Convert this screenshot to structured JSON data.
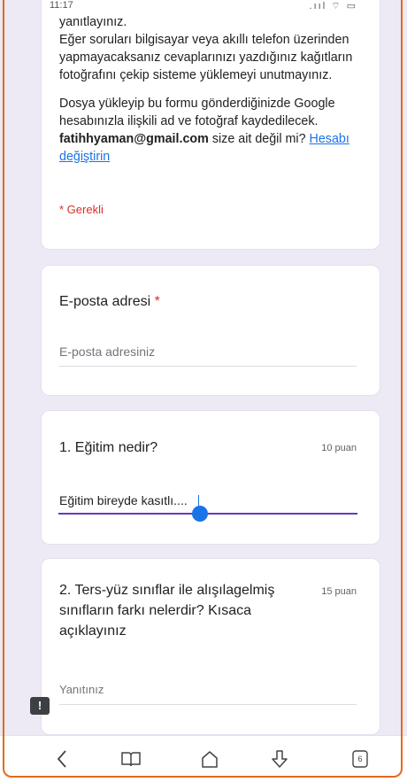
{
  "status": {
    "time": "11:17",
    "icons": ".ııl ⌔ ▭"
  },
  "intro": {
    "line_top": "yanıtlayınız.",
    "para1": "Eğer soruları bilgisayar veya akıllı telefon üzerinden yapmayacaksanız cevaplarınızı yazdığınız kağıtların fotoğrafını çekip sisteme yüklemeyi unutmayınız.",
    "para2_a": "Dosya yükleyip bu formu gönderdiğinizde Google hesabınızla ilişkili ad ve fotoğraf kaydedilecek. ",
    "email": "fatihhyaman@gmail.com",
    "para2_b": " size ait değil mi? ",
    "switch_account": "Hesabı değiştirin",
    "required_note": "* Gerekli"
  },
  "email_question": {
    "title": "E-posta adresi",
    "required_mark": "*",
    "placeholder": "E-posta adresiniz"
  },
  "question1": {
    "title": "1. Eğitim nedir?",
    "points": "10 puan",
    "answer": "Eğitim bireyde kasıtlı...."
  },
  "question2": {
    "title": "2. Ters-yüz sınıflar ile alışılagelmiş sınıfların farkı nelerdir? Kısaca açıklayınız",
    "points": "15 puan",
    "placeholder": "Yanıtınız"
  },
  "feedback": {
    "label": "!"
  },
  "navbar": {
    "tab_count": "6"
  },
  "colors": {
    "accent": "#673ab7",
    "link": "#1a73e8",
    "required": "#d93025",
    "frame": "#e26a1e"
  }
}
